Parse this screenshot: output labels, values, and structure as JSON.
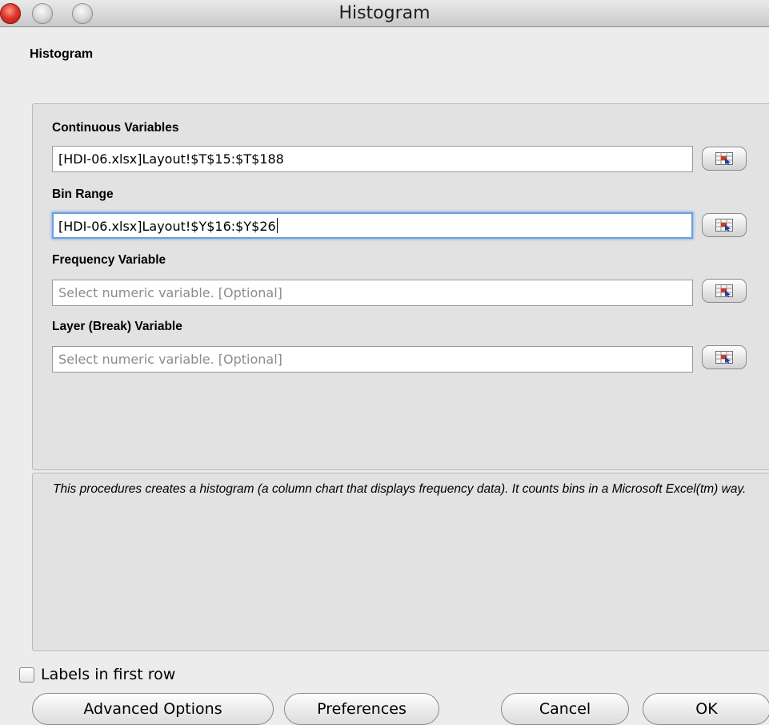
{
  "window": {
    "title": "Histogram"
  },
  "dialog": {
    "heading": "Histogram"
  },
  "fields": [
    {
      "label": "Continuous Variables",
      "value": "[HDI-06.xlsx]Layout!$T$15:$T$188",
      "placeholder": ""
    },
    {
      "label": "Bin Range",
      "value": "[HDI-06.xlsx]Layout!$Y$16:$Y$26",
      "placeholder": "",
      "focused": true
    },
    {
      "label": "Frequency Variable",
      "value": "",
      "placeholder": "Select numeric variable. [Optional]"
    },
    {
      "label": "Layer (Break) Variable",
      "value": "",
      "placeholder": "Select numeric variable. [Optional]"
    }
  ],
  "description": "This procedures creates a histogram (a column chart that displays frequency data). It counts bins in a Microsoft Excel(tm) way.",
  "options": {
    "labels_in_first_row": {
      "label": "Labels in first row",
      "checked": false
    }
  },
  "buttons": {
    "advanced": "Advanced Options",
    "preferences": "Preferences",
    "cancel": "Cancel",
    "ok": "OK"
  },
  "icons": {
    "range_selector": "range-select-icon"
  },
  "colors": {
    "focus_ring": "#6d9fe0",
    "close_button": "#e0382c"
  }
}
